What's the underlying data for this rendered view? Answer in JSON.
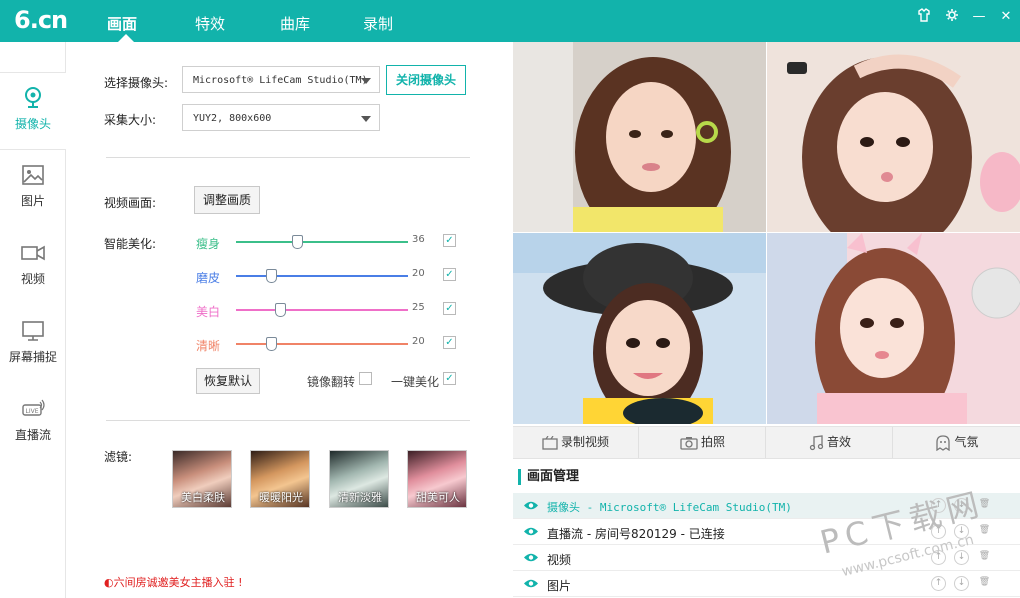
{
  "app": {
    "logo": "6.cn"
  },
  "nav": {
    "tabs": [
      {
        "label": "画面"
      },
      {
        "label": "特效"
      },
      {
        "label": "曲库"
      },
      {
        "label": "录制"
      }
    ]
  },
  "window_controls": {
    "skin": "skin-icon",
    "settings": "gear-icon",
    "minimize": "—",
    "close": "✕"
  },
  "sidebar": {
    "items": [
      {
        "label": "摄像头",
        "icon": "webcam-icon"
      },
      {
        "label": "图片",
        "icon": "image-icon"
      },
      {
        "label": "视频",
        "icon": "video-camera-icon"
      },
      {
        "label": "屏幕捕捉",
        "icon": "monitor-icon"
      },
      {
        "label": "直播流",
        "icon": "live-stream-icon"
      }
    ]
  },
  "camera": {
    "select_label": "选择摄像头:",
    "select_value": "Microsoft® LifeCam Studio(TM)",
    "close_button": "关闭摄像头",
    "size_label": "采集大小:",
    "size_value": "YUY2, 800x600"
  },
  "video": {
    "label": "视频画面:",
    "adjust_button": "调整画质",
    "beauty_label": "智能美化:",
    "sliders": [
      {
        "name": "瘦身",
        "value": "36",
        "color": "#3bbf8a"
      },
      {
        "name": "磨皮",
        "value": "20",
        "color": "#4a7ee6"
      },
      {
        "name": "美白",
        "value": "25",
        "color": "#ef6fc8"
      },
      {
        "name": "清晰",
        "value": "20",
        "color": "#f08367"
      }
    ],
    "reset_button": "恢复默认",
    "mirror_label": "镜像翻转",
    "one_click_label": "一键美化"
  },
  "filters": {
    "label": "滤镜:",
    "items": [
      "美白柔肤",
      "暖暖阳光",
      "清新淡雅",
      "甜美可人"
    ]
  },
  "notice": "◐六间房诚邀美女主播入驻 !",
  "actions": [
    {
      "label": "录制视频",
      "icon": "record-video-icon"
    },
    {
      "label": "拍照",
      "icon": "camera-icon"
    },
    {
      "label": "音效",
      "icon": "music-note-icon"
    },
    {
      "label": "气氛",
      "icon": "ghost-icon"
    }
  ],
  "layers": {
    "title": "画面管理",
    "rows": [
      {
        "text": "摄像头 - Microsoft® LifeCam Studio(TM)"
      },
      {
        "text": "直播流 - 房间号820129 - 已连接"
      },
      {
        "text": "视频"
      },
      {
        "text": "图片"
      }
    ]
  },
  "watermark": {
    "main": "PC下载网",
    "sub": "www.pcsoft.com.cn"
  },
  "colors": {
    "accent": "#12b3ab",
    "notice": "#e02020"
  }
}
